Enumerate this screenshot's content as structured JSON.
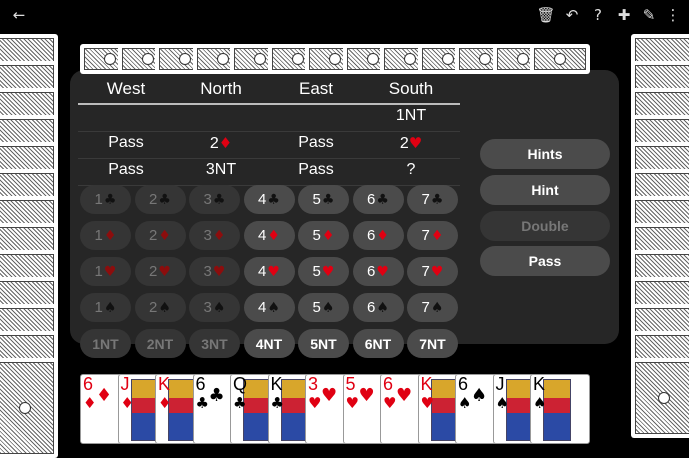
{
  "toolbar": {
    "back_icon": "←",
    "trash_icon": "🗑",
    "undo_icon": "↶",
    "help_icon": "?",
    "add_icon": "✚",
    "edit_icon": "✎",
    "more_icon": "⋮"
  },
  "auction": {
    "headers": [
      "West",
      "North",
      "East",
      "South"
    ],
    "rows": [
      [
        "",
        "",
        "",
        "1NT"
      ],
      [
        "Pass",
        "2♦",
        "Pass",
        "2♥"
      ],
      [
        "Pass",
        "3NT",
        "Pass",
        "?"
      ]
    ]
  },
  "bid_grid": {
    "rows": [
      [
        {
          "l": "1",
          "s": "♣"
        },
        {
          "l": "2",
          "s": "♣"
        },
        {
          "l": "3",
          "s": "♣"
        },
        {
          "l": "4",
          "s": "♣"
        },
        {
          "l": "5",
          "s": "♣"
        },
        {
          "l": "6",
          "s": "♣"
        },
        {
          "l": "7",
          "s": "♣"
        }
      ],
      [
        {
          "l": "1",
          "s": "♦"
        },
        {
          "l": "2",
          "s": "♦"
        },
        {
          "l": "3",
          "s": "♦"
        },
        {
          "l": "4",
          "s": "♦"
        },
        {
          "l": "5",
          "s": "♦"
        },
        {
          "l": "6",
          "s": "♦"
        },
        {
          "l": "7",
          "s": "♦"
        }
      ],
      [
        {
          "l": "1",
          "s": "♥"
        },
        {
          "l": "2",
          "s": "♥"
        },
        {
          "l": "3",
          "s": "♥"
        },
        {
          "l": "4",
          "s": "♥"
        },
        {
          "l": "5",
          "s": "♥"
        },
        {
          "l": "6",
          "s": "♥"
        },
        {
          "l": "7",
          "s": "♥"
        }
      ],
      [
        {
          "l": "1",
          "s": "♠"
        },
        {
          "l": "2",
          "s": "♠"
        },
        {
          "l": "3",
          "s": "♠"
        },
        {
          "l": "4",
          "s": "♠"
        },
        {
          "l": "5",
          "s": "♠"
        },
        {
          "l": "6",
          "s": "♠"
        },
        {
          "l": "7",
          "s": "♠"
        }
      ],
      [
        {
          "l": "1NT",
          "s": ""
        },
        {
          "l": "2NT",
          "s": ""
        },
        {
          "l": "3NT",
          "s": ""
        },
        {
          "l": "4NT",
          "s": ""
        },
        {
          "l": "5NT",
          "s": ""
        },
        {
          "l": "6NT",
          "s": ""
        },
        {
          "l": "7NT",
          "s": ""
        }
      ]
    ],
    "enabled_from_level": 4
  },
  "actions": {
    "hints": "Hints",
    "hint": "Hint",
    "double": "Double",
    "pass": "Pass"
  },
  "hand": [
    {
      "rank": "6",
      "suit": "♦"
    },
    {
      "rank": "J",
      "suit": "♦"
    },
    {
      "rank": "K",
      "suit": "♦"
    },
    {
      "rank": "6",
      "suit": "♣"
    },
    {
      "rank": "Q",
      "suit": "♣"
    },
    {
      "rank": "K",
      "suit": "♣"
    },
    {
      "rank": "3",
      "suit": "♥"
    },
    {
      "rank": "5",
      "suit": "♥"
    },
    {
      "rank": "6",
      "suit": "♥"
    },
    {
      "rank": "K",
      "suit": "♥"
    },
    {
      "rank": "6",
      "suit": "♠"
    },
    {
      "rank": "J",
      "suit": "♠"
    },
    {
      "rank": "K",
      "suit": "♠"
    }
  ],
  "colors": {
    "background": "#000000",
    "panel": "#262626",
    "button_enabled": "#4b4b4b",
    "button_disabled": "#353535",
    "red_suit": "#e00012"
  }
}
